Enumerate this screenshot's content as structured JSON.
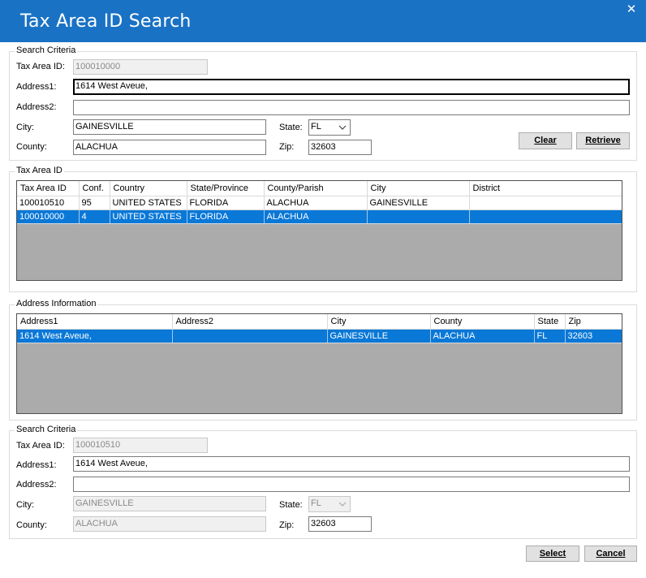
{
  "window": {
    "title": "Tax Area ID Search",
    "close_glyph": "✕"
  },
  "search_top": {
    "legend": "Search Criteria",
    "tax_area_label": "Tax Area ID:",
    "tax_area_value": "100010000",
    "address1_label": "Address1:",
    "address1_value": "1614 West Aveue,",
    "address2_label": "Address2:",
    "address2_value": "",
    "city_label": "City:",
    "city_value": "GAINESVILLE",
    "county_label": "County:",
    "county_value": "ALACHUA",
    "state_label": "State:",
    "state_value": "FL",
    "zip_label": "Zip:",
    "zip_value": "32603",
    "clear_label": "Clear",
    "retrieve_label": "Retrieve"
  },
  "tax_area_grid": {
    "legend": "Tax Area ID",
    "columns": [
      "Tax Area ID",
      "Conf.",
      "Country",
      "State/Province",
      "County/Parish",
      "City",
      "District"
    ],
    "rows": [
      [
        "100010510",
        "95",
        "UNITED STATES",
        "FLORIDA",
        "ALACHUA",
        "GAINESVILLE",
        ""
      ],
      [
        "100010000",
        "4",
        "UNITED STATES",
        "FLORIDA",
        "ALACHUA",
        "",
        ""
      ]
    ],
    "selected_row": 1
  },
  "address_grid": {
    "legend": "Address Information",
    "columns": [
      "Address1",
      "Address2",
      "City",
      "County",
      "State",
      "Zip"
    ],
    "rows": [
      [
        "1614 West Aveue,",
        "",
        "GAINESVILLE",
        "ALACHUA",
        "FL",
        "32603"
      ]
    ],
    "selected_row": 0
  },
  "search_bottom": {
    "legend": "Search Criteria",
    "tax_area_label": "Tax Area ID:",
    "tax_area_value": "100010510",
    "address1_label": "Address1:",
    "address1_value": "1614 West Aveue,",
    "address2_label": "Address2:",
    "address2_value": "",
    "city_label": "City:",
    "city_value": "GAINESVILLE",
    "county_label": "County:",
    "county_value": "ALACHUA",
    "state_label": "State:",
    "state_value": "FL",
    "zip_label": "Zip:",
    "zip_value": "32603"
  },
  "footer": {
    "select_label": "Select",
    "cancel_label": "Cancel"
  },
  "icons": {
    "close": "close-icon",
    "dropdown": "chevron-down-icon"
  },
  "colors": {
    "titlebar": "#1a72c4",
    "selection": "#0a78d7",
    "grid_empty": "#ababab"
  }
}
